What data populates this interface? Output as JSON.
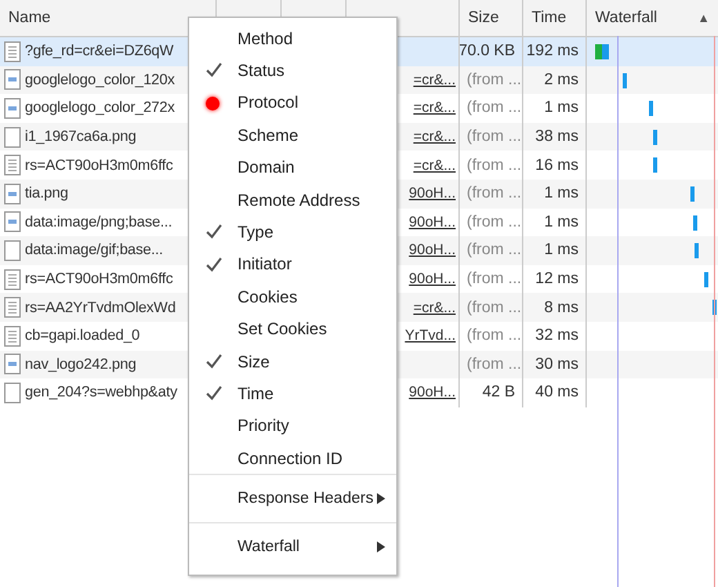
{
  "table": {
    "columns": [
      {
        "label": "Name"
      },
      {
        "label": "Size"
      },
      {
        "label": "Time"
      },
      {
        "label": "Waterfall",
        "sort_icon": "▲"
      }
    ],
    "rows": [
      {
        "name": "?gfe_rd=cr&ei=DZ6qW",
        "kind": "doc",
        "initiator": "",
        "size": "70.0 KB",
        "time": "192 ms",
        "selected": true
      },
      {
        "name": "googlelogo_color_120x",
        "kind": "image",
        "initiator": "=cr&...",
        "size": "(from ...",
        "time": "2 ms",
        "selected": false
      },
      {
        "name": "googlelogo_color_272x",
        "kind": "image",
        "initiator": "=cr&...",
        "size": "(from ...",
        "time": "1 ms",
        "selected": false
      },
      {
        "name": "i1_1967ca6a.png",
        "kind": "blank",
        "initiator": "=cr&...",
        "size": "(from ...",
        "time": "38 ms",
        "selected": false
      },
      {
        "name": "rs=ACT90oH3m0m6ffc",
        "kind": "doc",
        "initiator": "=cr&...",
        "size": "(from ...",
        "time": "16 ms",
        "selected": false
      },
      {
        "name": "tia.png",
        "kind": "image",
        "initiator": "90oH...",
        "size": "(from ...",
        "time": "1 ms",
        "selected": false
      },
      {
        "name": "data:image/png;base...",
        "kind": "image",
        "initiator": "90oH...",
        "size": "(from ...",
        "time": "1 ms",
        "selected": false
      },
      {
        "name": "data:image/gif;base...",
        "kind": "blank",
        "initiator": "90oH...",
        "size": "(from ...",
        "time": "1 ms",
        "selected": false
      },
      {
        "name": "rs=ACT90oH3m0m6ffc",
        "kind": "doc",
        "initiator": "90oH...",
        "size": "(from ...",
        "time": "12 ms",
        "selected": false
      },
      {
        "name": "rs=AA2YrTvdmOlexWd",
        "kind": "doc",
        "initiator": "=cr&...",
        "size": "(from ...",
        "time": "8 ms",
        "selected": false
      },
      {
        "name": "cb=gapi.loaded_0",
        "kind": "doc",
        "initiator": "YrTvd...",
        "size": "(from ...",
        "time": "32 ms",
        "selected": false
      },
      {
        "name": "nav_logo242.png",
        "kind": "image",
        "initiator": "",
        "size": "(from ...",
        "time": "30 ms",
        "selected": false
      },
      {
        "name": "gen_204?s=webhp&aty",
        "kind": "blank",
        "initiator": "90oH...",
        "size": "42 B",
        "time": "40 ms",
        "selected": false
      }
    ]
  },
  "context_menu": {
    "items": [
      {
        "kind": "option",
        "label": "Method",
        "checked": false,
        "dot": false
      },
      {
        "kind": "option",
        "label": "Status",
        "checked": true,
        "dot": false
      },
      {
        "kind": "option",
        "label": "Protocol",
        "checked": false,
        "dot": true
      },
      {
        "kind": "option",
        "label": "Scheme",
        "checked": false,
        "dot": false
      },
      {
        "kind": "option",
        "label": "Domain",
        "checked": false,
        "dot": false
      },
      {
        "kind": "option",
        "label": "Remote Address",
        "checked": false,
        "dot": false
      },
      {
        "kind": "option",
        "label": "Type",
        "checked": true,
        "dot": false
      },
      {
        "kind": "option",
        "label": "Initiator",
        "checked": true,
        "dot": false
      },
      {
        "kind": "option",
        "label": "Cookies",
        "checked": false,
        "dot": false
      },
      {
        "kind": "option",
        "label": "Set Cookies",
        "checked": false,
        "dot": false
      },
      {
        "kind": "option",
        "label": "Size",
        "checked": true,
        "dot": false
      },
      {
        "kind": "option",
        "label": "Time",
        "checked": true,
        "dot": false
      },
      {
        "kind": "option",
        "label": "Priority",
        "checked": false,
        "dot": false
      },
      {
        "kind": "option",
        "label": "Connection ID",
        "checked": false,
        "dot": false
      },
      {
        "kind": "submenu",
        "label": "Response Headers"
      },
      {
        "kind": "submenu",
        "label": "Waterfall"
      }
    ]
  }
}
